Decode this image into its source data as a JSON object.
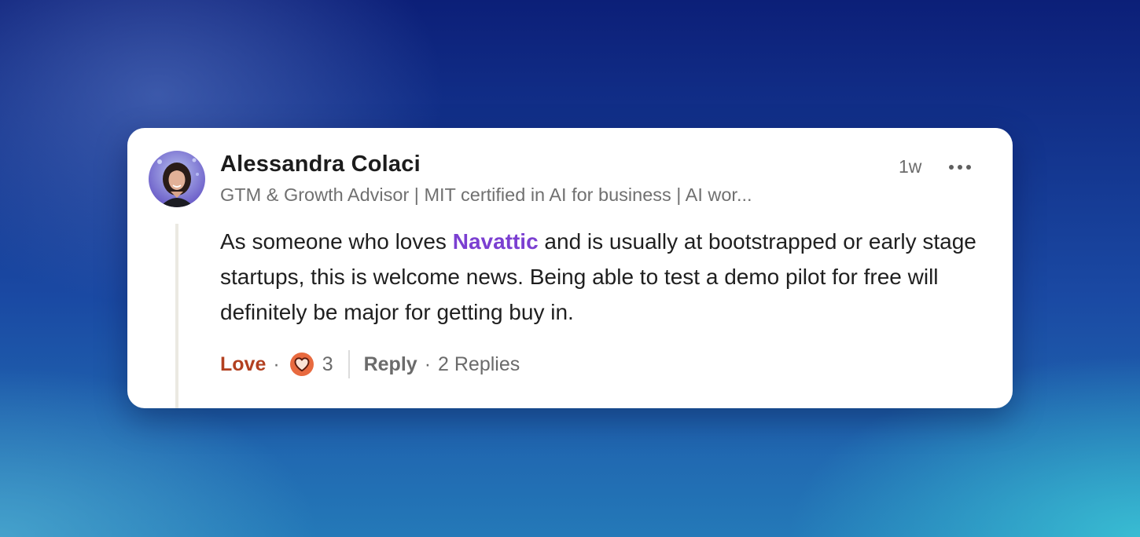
{
  "comment": {
    "author_name": "Alessandra Colaci",
    "author_headline": "GTM & Growth Advisor | MIT certified in AI for business | AI wor...",
    "timestamp": "1w",
    "body": {
      "before_mention": "As someone who loves ",
      "mention": "Navattic",
      "after_mention": " and is usually at bootstrapped or early stage startups, this is welcome news. Being able to test a demo pilot for free will definitely be major for getting buy in."
    },
    "actions": {
      "reaction_label": "Love",
      "separator": "·",
      "reaction_count": "3",
      "reply_label": "Reply",
      "replies_count_label": "2 Replies"
    },
    "icons": {
      "menu": "more-horizontal-icon",
      "reaction": "heart-reaction-icon"
    },
    "colors": {
      "mention": "#7b3fd1",
      "love": "#b24020",
      "reaction_badge": "#e86a3f"
    }
  }
}
